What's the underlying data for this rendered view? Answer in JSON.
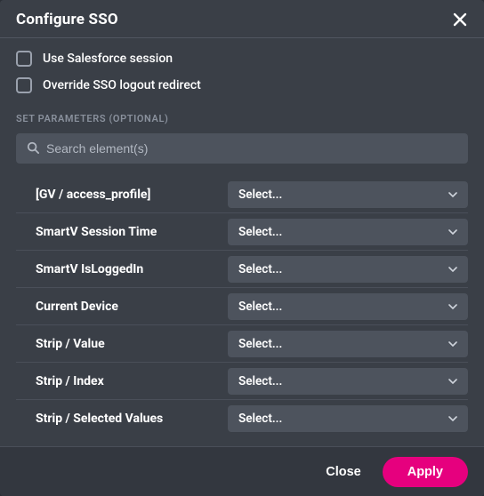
{
  "header": {
    "title": "Configure SSO"
  },
  "checkboxes": [
    {
      "label": "Use Salesforce session",
      "checked": false
    },
    {
      "label": "Override SSO logout redirect",
      "checked": false
    }
  ],
  "section_label": "SET PARAMETERS (OPTIONAL)",
  "search": {
    "placeholder": "Search element(s)",
    "value": ""
  },
  "select_placeholder": "Select...",
  "parameters": [
    {
      "label": "[GV / access_profile]"
    },
    {
      "label": "SmartV Session Time"
    },
    {
      "label": "SmartV IsLoggedIn"
    },
    {
      "label": "Current Device"
    },
    {
      "label": "Strip / Value"
    },
    {
      "label": "Strip / Index"
    },
    {
      "label": "Strip / Selected Values"
    }
  ],
  "footer": {
    "close_label": "Close",
    "apply_label": "Apply"
  },
  "colors": {
    "accent": "#e6007e"
  }
}
